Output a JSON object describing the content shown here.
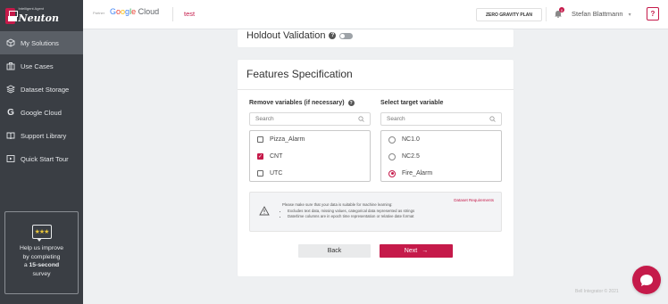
{
  "brand": {
    "subtitle": "Intelligent Agent",
    "name": "Neuton"
  },
  "sidebar": {
    "items": [
      {
        "label": "My Solutions",
        "icon": "cube-icon",
        "active": true
      },
      {
        "label": "Use Cases",
        "icon": "briefcase-icon",
        "active": false
      },
      {
        "label": "Dataset Storage",
        "icon": "layers-icon",
        "active": false
      },
      {
        "label": "Google Cloud",
        "icon": "google-g-icon",
        "active": false
      },
      {
        "label": "Support Library",
        "icon": "book-icon",
        "active": false
      },
      {
        "label": "Quick Start Tour",
        "icon": "play-screen-icon",
        "active": false
      }
    ],
    "survey": {
      "line1": "Help us improve",
      "line2": "by completing",
      "line3_prefix": "a ",
      "line3_bold": "15-second",
      "line4": "survey"
    }
  },
  "topbar": {
    "partner_label": "Partner",
    "gcloud_google": "Google",
    "gcloud_cloud": " Cloud",
    "project": "test",
    "plan_button": "ZERO GRAVITY PLAN",
    "notification_count": "0",
    "user_name": "Stefan Blattmann",
    "help_label": "?"
  },
  "holdout": {
    "title": "Holdout Validation"
  },
  "features": {
    "title": "Features Specification",
    "remove_label": "Remove variables (if necessary)",
    "target_label": "Select target variable",
    "search_placeholder": "Search",
    "remove_items": [
      {
        "label": "Pizza_Alarm",
        "checked": false
      },
      {
        "label": "CNT",
        "checked": true
      },
      {
        "label": "UTC",
        "checked": false
      }
    ],
    "target_items": [
      {
        "label": "NC1.0",
        "selected": false
      },
      {
        "label": "NC2.5",
        "selected": false
      },
      {
        "label": "Fire_Alarm",
        "selected": true
      }
    ],
    "note": {
      "intro": "Please make sure that your data is suitable for machine learning:",
      "bullet1": "Excludes text data, missing values, categorical data represented as strings",
      "bullet2": "Date/time columns are in epoch time representation or relative date format",
      "link": "Dataset Requirements"
    },
    "back_label": "Back",
    "next_label": "Next",
    "next_arrow": "→"
  },
  "footer": {
    "text": "Bell Integrator © 2021"
  },
  "colors": {
    "accent": "#c51a4a",
    "sidebar_bg": "#3a3e44",
    "sidebar_active": "#5a5f66",
    "page_bg": "#eef0f2"
  }
}
